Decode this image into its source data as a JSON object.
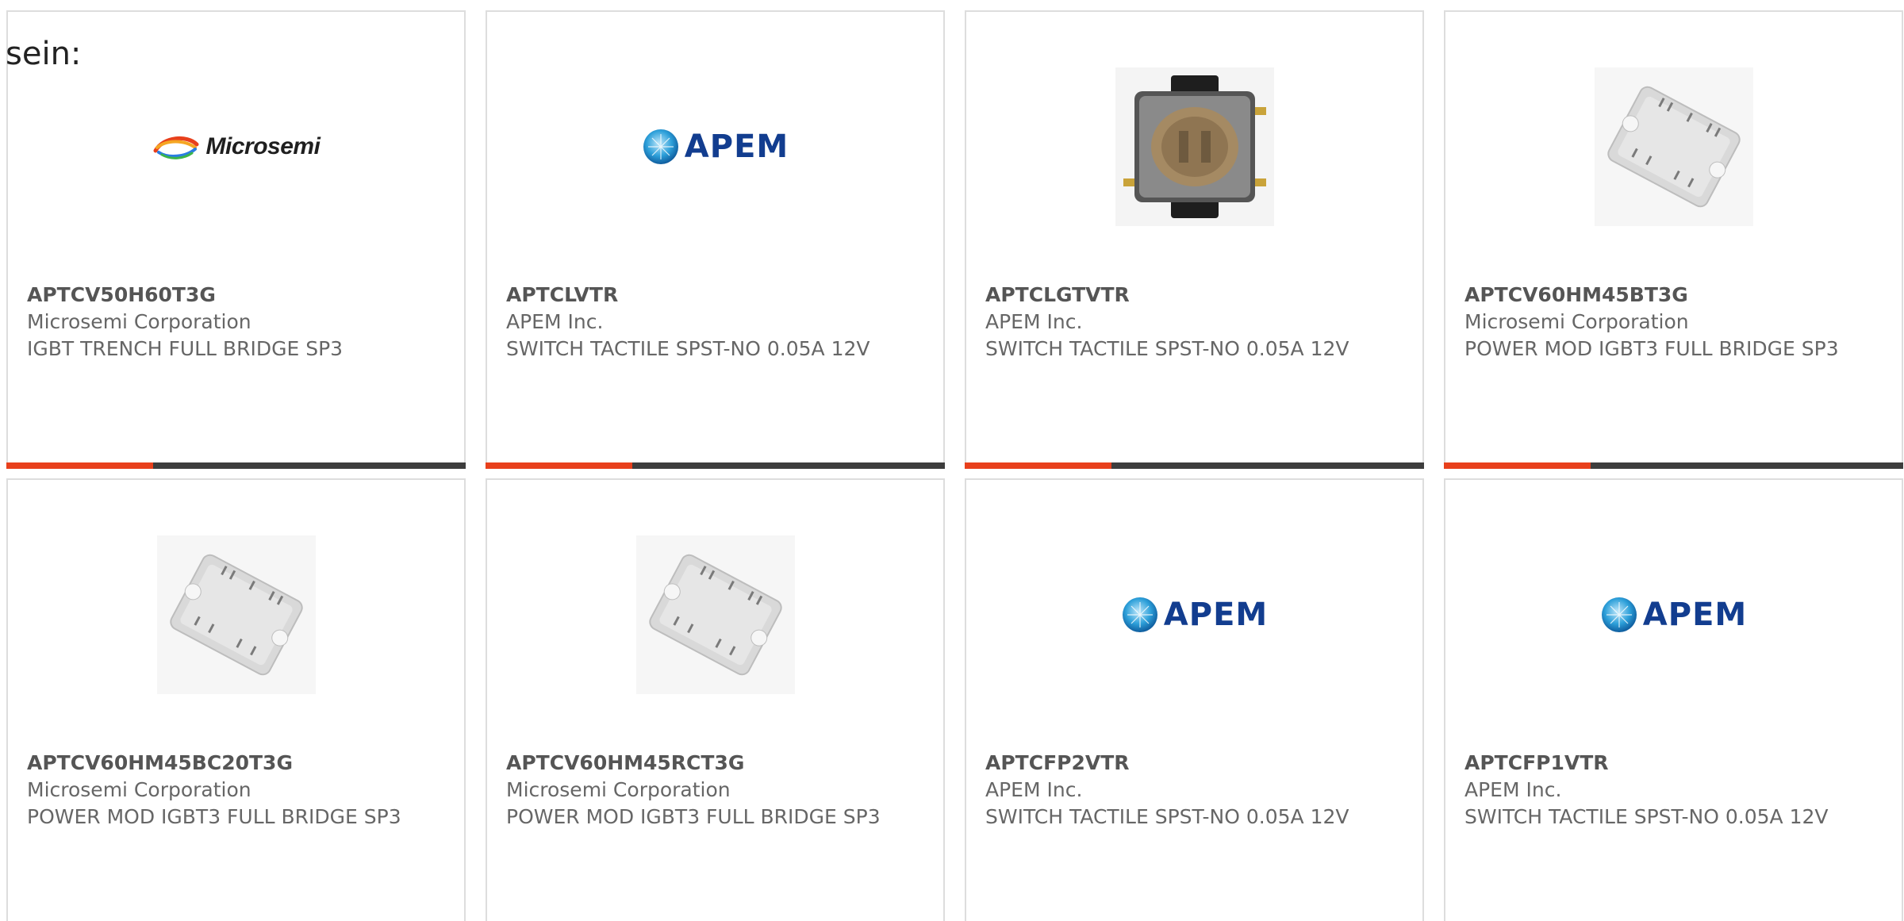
{
  "page": {
    "lead_text": "sein:"
  },
  "colors": {
    "accent": "#e8401c",
    "bar_dark": "#3d3d3d",
    "card_border": "#dddddd",
    "text": "#666666",
    "apem_blue": "#123d8f"
  },
  "products": [
    {
      "part_number": "APTCV50H60T3G",
      "manufacturer": "Microsemi Corporation",
      "description": "IGBT TRENCH FULL BRIDGE SP3",
      "image": "microsemi-logo",
      "logo_text": "Microsemi"
    },
    {
      "part_number": "APTCLVTR",
      "manufacturer": "APEM Inc.",
      "description": "SWITCH TACTILE SPST-NO 0.05A 12V",
      "image": "apem-logo",
      "logo_text": "APEM"
    },
    {
      "part_number": "APTCLGTVTR",
      "manufacturer": "APEM Inc.",
      "description": "SWITCH TACTILE SPST-NO 0.05A 12V",
      "image": "tactile-switch-photo"
    },
    {
      "part_number": "APTCV60HM45BT3G",
      "manufacturer": "Microsemi Corporation",
      "description": "POWER MOD IGBT3 FULL BRIDGE SP3",
      "image": "power-module-photo"
    },
    {
      "part_number": "APTCV60HM45BC20T3G",
      "manufacturer": "Microsemi Corporation",
      "description": "POWER MOD IGBT3 FULL BRIDGE SP3",
      "image": "power-module-photo"
    },
    {
      "part_number": "APTCV60HM45RCT3G",
      "manufacturer": "Microsemi Corporation",
      "description": "POWER MOD IGBT3 FULL BRIDGE SP3",
      "image": "power-module-photo"
    },
    {
      "part_number": "APTCFP2VTR",
      "manufacturer": "APEM Inc.",
      "description": "SWITCH TACTILE SPST-NO 0.05A 12V",
      "image": "apem-logo",
      "logo_text": "APEM"
    },
    {
      "part_number": "APTCFP1VTR",
      "manufacturer": "APEM Inc.",
      "description": "SWITCH TACTILE SPST-NO 0.05A 12V",
      "image": "apem-logo",
      "logo_text": "APEM"
    }
  ]
}
